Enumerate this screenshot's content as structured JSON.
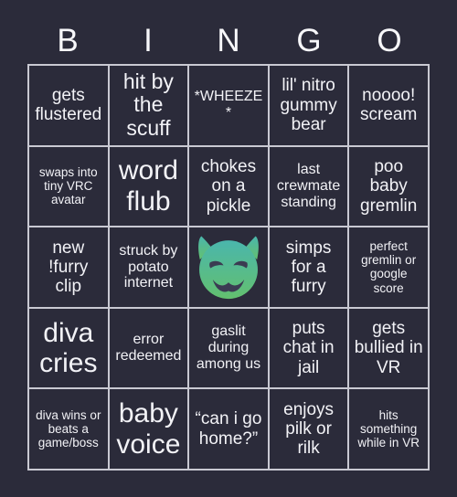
{
  "header": {
    "letters": [
      "B",
      "I",
      "N",
      "G",
      "O"
    ]
  },
  "colors": {
    "background": "#2b2b3a",
    "cell_fill": "#2b2b3a",
    "grid_line": "#c9c9d2",
    "text": "#f2f2f6",
    "emoji_top": "#4ab6ac",
    "emoji_bottom": "#63c06f",
    "emoji_face": "#3b3b52"
  },
  "grid": {
    "rows": 5,
    "columns": 5,
    "cells": [
      {
        "text": "gets flustered",
        "size": "size-md",
        "free": false
      },
      {
        "text": "hit by the scuff",
        "size": "size-lg",
        "free": false
      },
      {
        "text": "*WHEEZE*",
        "size": "size-sm",
        "free": false
      },
      {
        "text": "lil' nitro gummy bear",
        "size": "size-md",
        "free": false
      },
      {
        "text": "noooo! scream",
        "size": "size-md",
        "free": false
      },
      {
        "text": "swaps into tiny VRC avatar",
        "size": "size-xs",
        "free": false
      },
      {
        "text": "word flub",
        "size": "size-xl",
        "free": false
      },
      {
        "text": "chokes on a pickle",
        "size": "size-md",
        "free": false
      },
      {
        "text": "last crewmate standing",
        "size": "size-sm",
        "free": false
      },
      {
        "text": "poo baby gremlin",
        "size": "size-md",
        "free": false
      },
      {
        "text": "new !furry clip",
        "size": "size-md",
        "free": false
      },
      {
        "text": "struck by potato internet",
        "size": "size-sm",
        "free": false
      },
      {
        "text": "smiling-imp-emoji",
        "size": "size-md",
        "free": true
      },
      {
        "text": "simps for a furry",
        "size": "size-md",
        "free": false
      },
      {
        "text": "perfect gremlin or google score",
        "size": "size-xs",
        "free": false
      },
      {
        "text": "diva cries",
        "size": "size-xl",
        "free": false
      },
      {
        "text": "error redeemed",
        "size": "size-sm",
        "free": false
      },
      {
        "text": "gaslit during among us",
        "size": "size-sm",
        "free": false
      },
      {
        "text": "puts chat in jail",
        "size": "size-md",
        "free": false
      },
      {
        "text": "gets bullied in VR",
        "size": "size-md",
        "free": false
      },
      {
        "text": "diva wins or beats a game/boss",
        "size": "size-xs",
        "free": false
      },
      {
        "text": "baby voice",
        "size": "size-xl",
        "free": false
      },
      {
        "text": "“can i go home?”",
        "size": "size-md",
        "free": false
      },
      {
        "text": "enjoys pilk or rilk",
        "size": "size-md",
        "free": false
      },
      {
        "text": "hits something while in VR",
        "size": "size-xs",
        "free": false
      }
    ]
  }
}
